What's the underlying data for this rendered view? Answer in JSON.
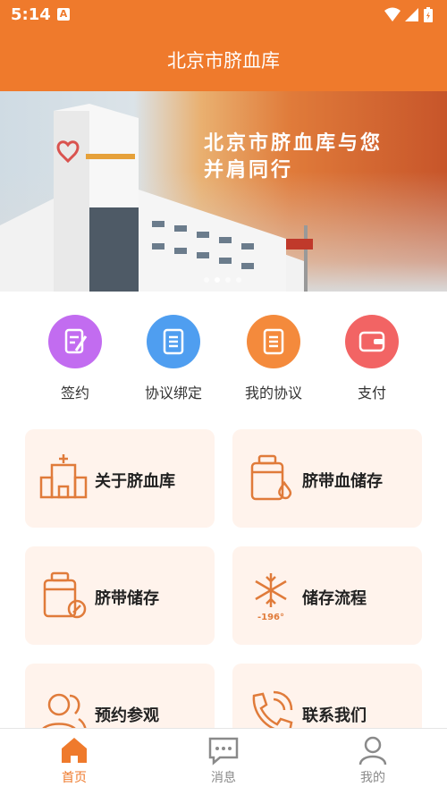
{
  "status_bar": {
    "time": "5:14",
    "notification_letter": "A"
  },
  "app_bar": {
    "title": "北京市脐血库"
  },
  "banner": {
    "line1": "北京市脐血库与您",
    "line2": "并肩同行",
    "total_slides": 4,
    "active_slide": 2
  },
  "quick_actions": [
    {
      "label": "签约",
      "color": "#c26cf0",
      "icon": "sign-contract-icon"
    },
    {
      "label": "协议绑定",
      "color": "#4f9ef0",
      "icon": "document-icon"
    },
    {
      "label": "我的协议",
      "color": "#f48a3c",
      "icon": "document-icon"
    },
    {
      "label": "支付",
      "color": "#f26464",
      "icon": "wallet-icon"
    }
  ],
  "cards": [
    {
      "label": "关于脐血库",
      "icon": "hospital-building-icon"
    },
    {
      "label": "脐带血储存",
      "icon": "blood-bottle-icon"
    },
    {
      "label": "脐带储存",
      "icon": "storage-bottle-icon"
    },
    {
      "label": "储存流程",
      "icon": "snowflake-icon",
      "icon_text": "-196°"
    },
    {
      "label": "预约参观",
      "icon": "people-icon"
    },
    {
      "label": "联系我们",
      "icon": "phone-icon"
    }
  ],
  "tab_bar": {
    "tabs": [
      {
        "label": "首页",
        "icon": "home-icon",
        "active": true
      },
      {
        "label": "消息",
        "icon": "message-icon",
        "active": false
      },
      {
        "label": "我的",
        "icon": "profile-icon",
        "active": false
      }
    ]
  },
  "colors": {
    "brand": "#ef7a2c",
    "card_bg": "#fff3ec"
  }
}
